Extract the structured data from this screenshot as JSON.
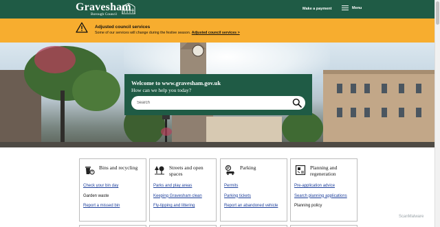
{
  "header": {
    "logo_name": "Gravesham",
    "logo_sub": "Borough Council",
    "payment_link": "Make a payment",
    "menu_label": "Menu",
    "bg_color": "#1f5b45"
  },
  "alert": {
    "title": "Adjusted council services",
    "text": "Some of our services will change during the festive season.",
    "link": "Adjusted council services >",
    "icon": "warning-icon",
    "bg_color": "#f7ad2f"
  },
  "hero": {
    "title": "Welcome to www.gravesham.gov.uk",
    "subtitle": "How can we help you today?",
    "search_placeholder": "Search"
  },
  "cards": [
    {
      "title": "Bins and recycling",
      "icon": "bin-icon",
      "links": [
        {
          "label": "Check your bin day"
        },
        {
          "label": "Garden waste",
          "plain": true
        },
        {
          "label": "Report a missed bin"
        }
      ]
    },
    {
      "title": "Streets and open spaces",
      "icon": "trees-icon",
      "links": [
        {
          "label": "Parks and play areas"
        },
        {
          "label": "Keeping Gravesham clean"
        },
        {
          "label": "Fly-tipping and littering"
        }
      ]
    },
    {
      "title": "Parking",
      "icon": "car-icon",
      "links": [
        {
          "label": "Permits"
        },
        {
          "label": "Parking tickets"
        },
        {
          "label": "Report an abandoned vehicle"
        }
      ]
    },
    {
      "title": "Planning and regeneration",
      "icon": "planning-icon",
      "links": [
        {
          "label": "Pre-application advice"
        },
        {
          "label": "Search planning applications"
        },
        {
          "label": "Planning policy",
          "plain": true
        }
      ]
    }
  ],
  "watermark": "ScanMalware",
  "link_color": "#1d3f9b"
}
